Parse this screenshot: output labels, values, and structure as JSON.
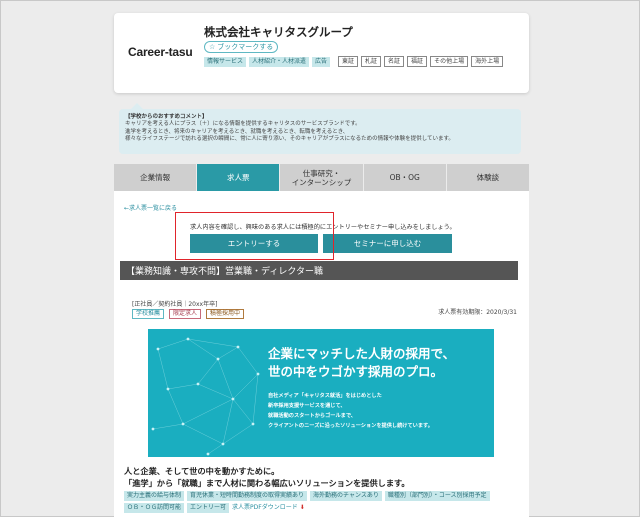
{
  "company": {
    "logo_text": "Career-tasu",
    "name": "株式会社キャリタスグループ",
    "bookmark_label": "ブックマークする",
    "industry_tags": [
      "情報サービス",
      "人材紹介・人材派遣",
      "広告"
    ],
    "info_tags": [
      "東証",
      "札証",
      "名証",
      "福証",
      "その他上場",
      "海外上場"
    ]
  },
  "recommend": {
    "title": "【学校からのおすすめコメント】",
    "lines": [
      "キャリアを考える人にプラス（＋）になる情報を提供するキャリタスのサービスブランドです。",
      "進学を考えるとき、将来のキャリアを考えるとき、就職を考えるとき、転職を考えるとき、",
      "様々なライフステージで訪れる選択の瞬間に、常に人に寄り添い、そのキャリアがプラスになるための情報や体験を提供しています。"
    ]
  },
  "tabs": [
    {
      "label": "企業情報",
      "active": false
    },
    {
      "label": "求人票",
      "active": true
    },
    {
      "label": "仕事研究・\nインターンシップ",
      "active": false
    },
    {
      "label": "OB・OG",
      "active": false
    },
    {
      "label": "体験談",
      "active": false
    }
  ],
  "panel": {
    "back_link": "←求人票一覧に戻る",
    "notice": "求人内容を確認し、興味のある求人には積極的にエントリーやセミナー申し込みをしましょう。",
    "entry_button": "エントリーする",
    "seminar_button": "セミナーに申し込む",
    "job_title": "【業務知識・専攻不問】営業職・ディレクター職",
    "employment_type": "[正社員／契約社員｜20xx年卒]",
    "badges": [
      "学校推薦",
      "限定求人",
      "積極採用中"
    ],
    "deadline": "求人票有効期限：2020/3/31",
    "banner": {
      "headline_1": "企業にマッチした人財の採用で、",
      "headline_2": "世の中をウゴかす採用のプロ。",
      "body": [
        "自社メディア「キャリタス就活」をはじめとした",
        "新卒採用支援サービスを通じて、",
        "就職活動のスタートからゴールまで、",
        "クライアントのニーズに沿ったソリューションを提供し続けています。"
      ]
    },
    "catch_1": "人と企業、そして世の中を動かすために。",
    "catch_2": "「進学」から「就職」まで人材に関わる幅広いソリューションを提供します。",
    "feature_tags": [
      "実力主義の給与体制",
      "育児休業・短時間勤務制度の取得実績あり",
      "海外勤務のチャンスあり",
      "職種別（部門別）・コース別採用予定",
      "ＯＢ・ＯＧ訪問可能",
      "エントリー可"
    ],
    "pdf_link": "求人票PDFダウンロード"
  },
  "colors": {
    "accent": "#2a9aa6",
    "highlight_box": "#e0242b",
    "title_bar": "#555555",
    "banner": "#1aaec0"
  }
}
